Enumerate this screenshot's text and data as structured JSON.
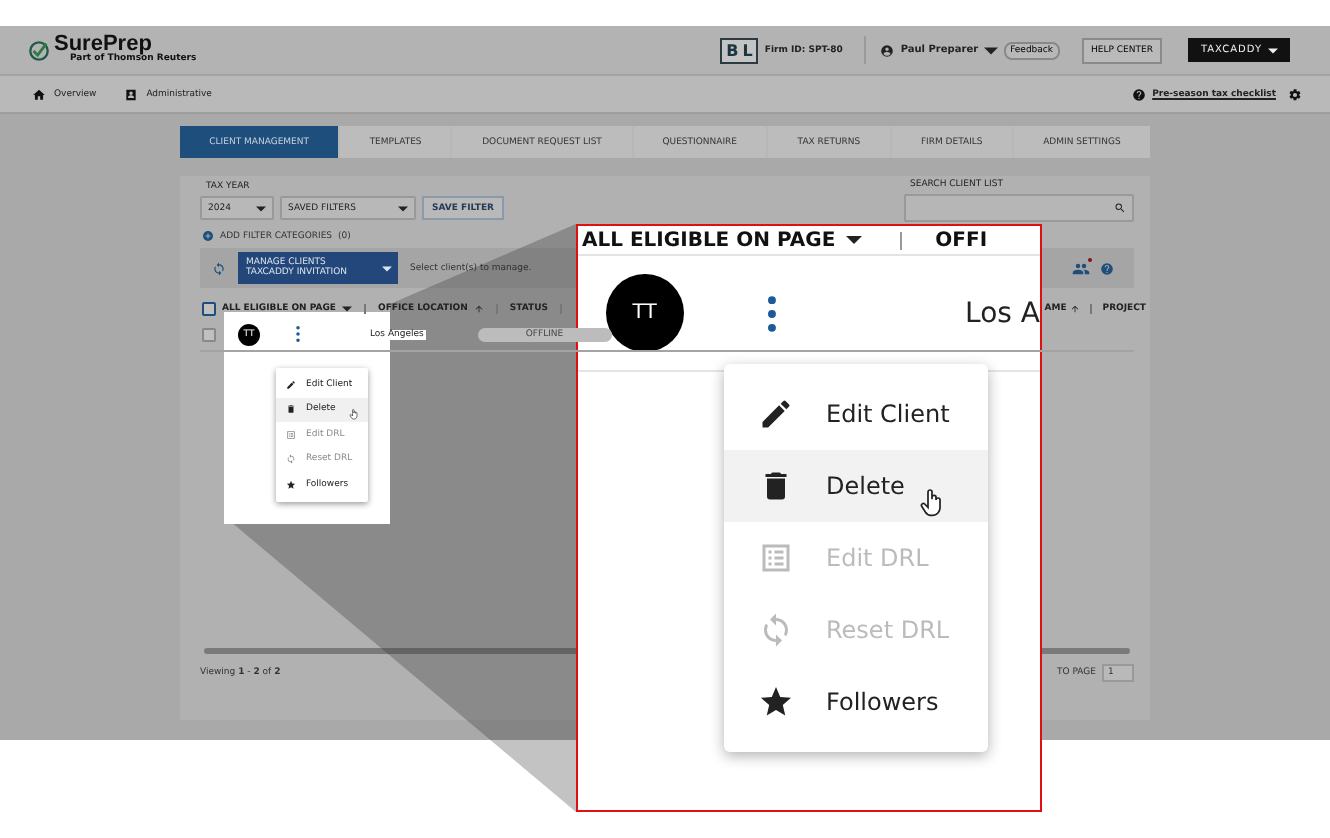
{
  "header": {
    "brand": "SurePrep",
    "brand_sub": "Part of Thomson Reuters",
    "firm_logo": [
      "B",
      "L"
    ],
    "firm_id": "Firm ID: SPT-80",
    "user": "Paul Preparer",
    "feedback": "Feedback",
    "help": "HELP CENTER",
    "product": "TAXCADDY"
  },
  "nav": {
    "items": [
      {
        "label": "Overview"
      },
      {
        "label": "Administrative"
      }
    ],
    "checklist": "Pre-season tax checklist"
  },
  "tabs": [
    {
      "label": "CLIENT MANAGEMENT",
      "selected": true
    },
    {
      "label": "TEMPLATES",
      "selected": false
    },
    {
      "label": "DOCUMENT REQUEST LIST",
      "selected": false
    },
    {
      "label": "QUESTIONNAIRE",
      "selected": false
    },
    {
      "label": "TAX RETURNS",
      "selected": false
    },
    {
      "label": "FIRM DETAILS",
      "selected": false
    },
    {
      "label": "ADMIN SETTINGS",
      "selected": false
    }
  ],
  "filters": {
    "tax_year_label": "TAX YEAR",
    "tax_year": "2024",
    "saved_filters": "SAVED FILTERS",
    "save_button": "SAVE FILTER",
    "search_label": "SEARCH CLIENT LIST",
    "add_filter": "ADD FILTER CATEGORIES",
    "filter_count": "(0)"
  },
  "actions": {
    "manage_label": "MANAGE CLIENTS",
    "manage_value": "TAXCADDY INVITATION",
    "hint": "Select client(s) to manage."
  },
  "columns": [
    {
      "label": "ALL ELIGIBLE ON PAGE",
      "kind": "select",
      "checked": false
    },
    {
      "label": "OFFICE LOCATION",
      "kind": "sort"
    },
    {
      "label": "STATUS",
      "kind": "plain"
    }
  ],
  "columns_right": [
    {
      "label": "AME",
      "kind": "sort"
    },
    {
      "label": "PROJECT",
      "kind": "plain"
    }
  ],
  "row": {
    "checked": false,
    "initials": "TT",
    "location": "Los Angeles",
    "status": "OFFLINE",
    "menu": [
      {
        "label": "Edit Client",
        "kind": "pencil",
        "disabled": false,
        "highlighted": false
      },
      {
        "label": "Delete",
        "kind": "trash",
        "disabled": false,
        "highlighted": true
      },
      {
        "label": "Edit DRL",
        "kind": "list",
        "disabled": true,
        "highlighted": false
      },
      {
        "label": "Reset DRL",
        "kind": "refresh",
        "disabled": true,
        "highlighted": false
      },
      {
        "label": "Followers",
        "kind": "star",
        "disabled": false,
        "highlighted": false
      }
    ]
  },
  "footer": {
    "viewing": "Viewing **1** - **2** of **2**",
    "goto_label": "TO PAGE",
    "page": "1"
  },
  "callout": {
    "header": "ALL ELIGIBLE ON PAGE",
    "column": "OFFI",
    "initials": "TT",
    "location": "Los A",
    "menu": [
      {
        "label": "Edit Client",
        "kind": "pencil",
        "disabled": false,
        "highlighted": false
      },
      {
        "label": "Delete",
        "kind": "trash",
        "disabled": false,
        "highlighted": true
      },
      {
        "label": "Edit DRL",
        "kind": "list",
        "disabled": true,
        "highlighted": false
      },
      {
        "label": "Reset DRL",
        "kind": "refresh",
        "disabled": true,
        "highlighted": false
      },
      {
        "label": "Followers",
        "kind": "star",
        "disabled": false,
        "highlighted": false
      }
    ]
  }
}
